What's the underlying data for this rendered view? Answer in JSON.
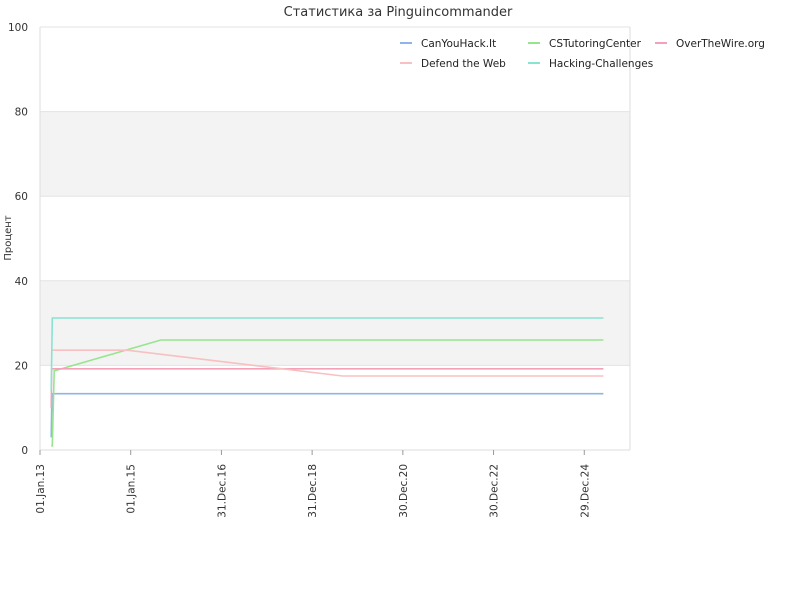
{
  "chart_data": {
    "type": "line",
    "title": "Статистика за Pinguincommander",
    "xlabel": "",
    "ylabel": "Процент",
    "ylim": [
      0,
      100
    ],
    "y_ticks": [
      0,
      20,
      40,
      60,
      80,
      100
    ],
    "x_range": [
      "2013-01-01",
      "2026-01-01"
    ],
    "x_ticks": [
      {
        "date": "2013-01-01",
        "label": "01.Jan.13"
      },
      {
        "date": "2015-01-01",
        "label": "01.Jan.15"
      },
      {
        "date": "2016-12-31",
        "label": "31.Dec.16"
      },
      {
        "date": "2018-12-31",
        "label": "31.Dec.18"
      },
      {
        "date": "2020-12-30",
        "label": "30.Dec.20"
      },
      {
        "date": "2022-12-30",
        "label": "30.Dec.22"
      },
      {
        "date": "2024-12-29",
        "label": "29.Dec.24"
      }
    ],
    "grid": true,
    "legend_position": "top-right",
    "series": [
      {
        "name": "CanYouHack.It",
        "color": "#8fb4ea",
        "points": [
          [
            "2013-04-01",
            3
          ],
          [
            "2013-04-05",
            10
          ],
          [
            "2013-04-10",
            13.3
          ],
          [
            "2025-06-01",
            13.3
          ]
        ]
      },
      {
        "name": "CSTutoringCenter",
        "color": "#96e58e",
        "points": [
          [
            "2013-04-01",
            1
          ],
          [
            "2013-04-10",
            1
          ],
          [
            "2013-04-25",
            18.7
          ],
          [
            "2015-09-01",
            26
          ],
          [
            "2025-06-01",
            26
          ]
        ]
      },
      {
        "name": "OverTheWire.org",
        "color": "#f3a1b8",
        "points": [
          [
            "2013-04-01",
            10
          ],
          [
            "2013-04-05",
            19.2
          ],
          [
            "2025-06-01",
            19.2
          ]
        ]
      },
      {
        "name": "Defend the Web",
        "color": "#f8c0c0",
        "points": [
          [
            "2013-04-10",
            23.6
          ],
          [
            "2014-12-01",
            23.6
          ],
          [
            "2019-09-01",
            17.5
          ],
          [
            "2025-06-01",
            17.5
          ]
        ]
      },
      {
        "name": "Hacking-Challenges",
        "color": "#88e3d1",
        "points": [
          [
            "2013-04-01",
            14
          ],
          [
            "2013-04-10",
            31.2
          ],
          [
            "2025-06-01",
            31.2
          ]
        ]
      }
    ]
  }
}
